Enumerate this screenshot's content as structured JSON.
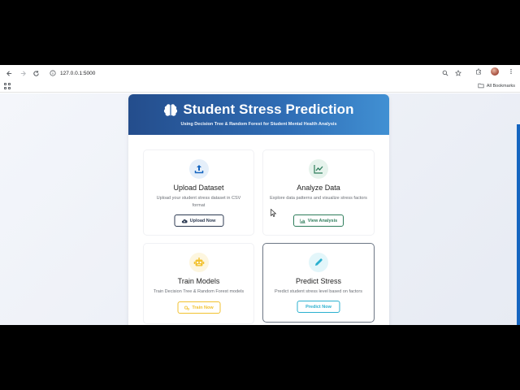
{
  "browser": {
    "url": "127.0.0.1:5000",
    "bookmarks_label": "All Bookmarks"
  },
  "header": {
    "title": "Student Stress Prediction",
    "subtitle": "Using Decision Tree & Random Forest for Student Mental Health Analysis"
  },
  "cards": [
    {
      "title": "Upload Dataset",
      "description": "Upload your student stress dataset in CSV format",
      "button": "Upload Now",
      "icon": "upload-icon",
      "color": "#1565c0",
      "bg": "#e5effa"
    },
    {
      "title": "Analyze Data",
      "description": "Explore data patterns and visualize stress factors",
      "button": "View Analysis",
      "icon": "chart-line-icon",
      "color": "#2e7d5b",
      "bg": "#e6f3ec"
    },
    {
      "title": "Train Models",
      "description": "Train Decision Tree & Random Forest models",
      "button": "Train Now",
      "icon": "robot-icon",
      "color": "#f2c230",
      "bg": "#fdf6df"
    },
    {
      "title": "Predict Stress",
      "description": "Predict student stress level based on factors",
      "button": "Predict Now",
      "icon": "pen-icon",
      "color": "#2bb0cf",
      "bg": "#e3f6fa"
    }
  ]
}
